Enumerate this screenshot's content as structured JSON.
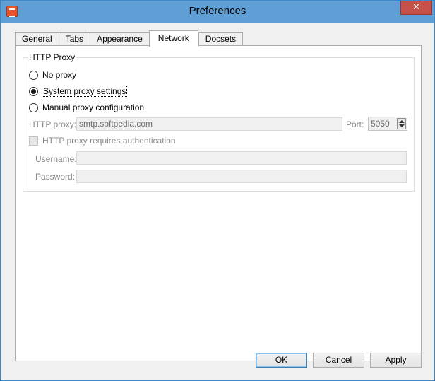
{
  "window": {
    "title": "Preferences",
    "close_glyph": "✕"
  },
  "tabs": [
    {
      "label": "General",
      "active": false
    },
    {
      "label": "Tabs",
      "active": false
    },
    {
      "label": "Appearance",
      "active": false
    },
    {
      "label": "Network",
      "active": true
    },
    {
      "label": "Docsets",
      "active": false
    }
  ],
  "proxy": {
    "group_title": "HTTP Proxy",
    "options": [
      {
        "label": "No proxy",
        "checked": false
      },
      {
        "label": "System proxy settings",
        "checked": true
      },
      {
        "label": "Manual proxy configuration",
        "checked": false
      }
    ],
    "http_proxy_label": "HTTP proxy:",
    "http_proxy_value": "smtp.softpedia.com",
    "port_label": "Port:",
    "port_value": "5050",
    "auth_label": "HTTP proxy requires authentication",
    "username_label": "Username:",
    "username_value": "",
    "password_label": "Password:",
    "password_value": ""
  },
  "buttons": {
    "ok": "OK",
    "cancel": "Cancel",
    "apply": "Apply"
  },
  "icons": {
    "app": "app-icon",
    "close": "close-icon"
  }
}
